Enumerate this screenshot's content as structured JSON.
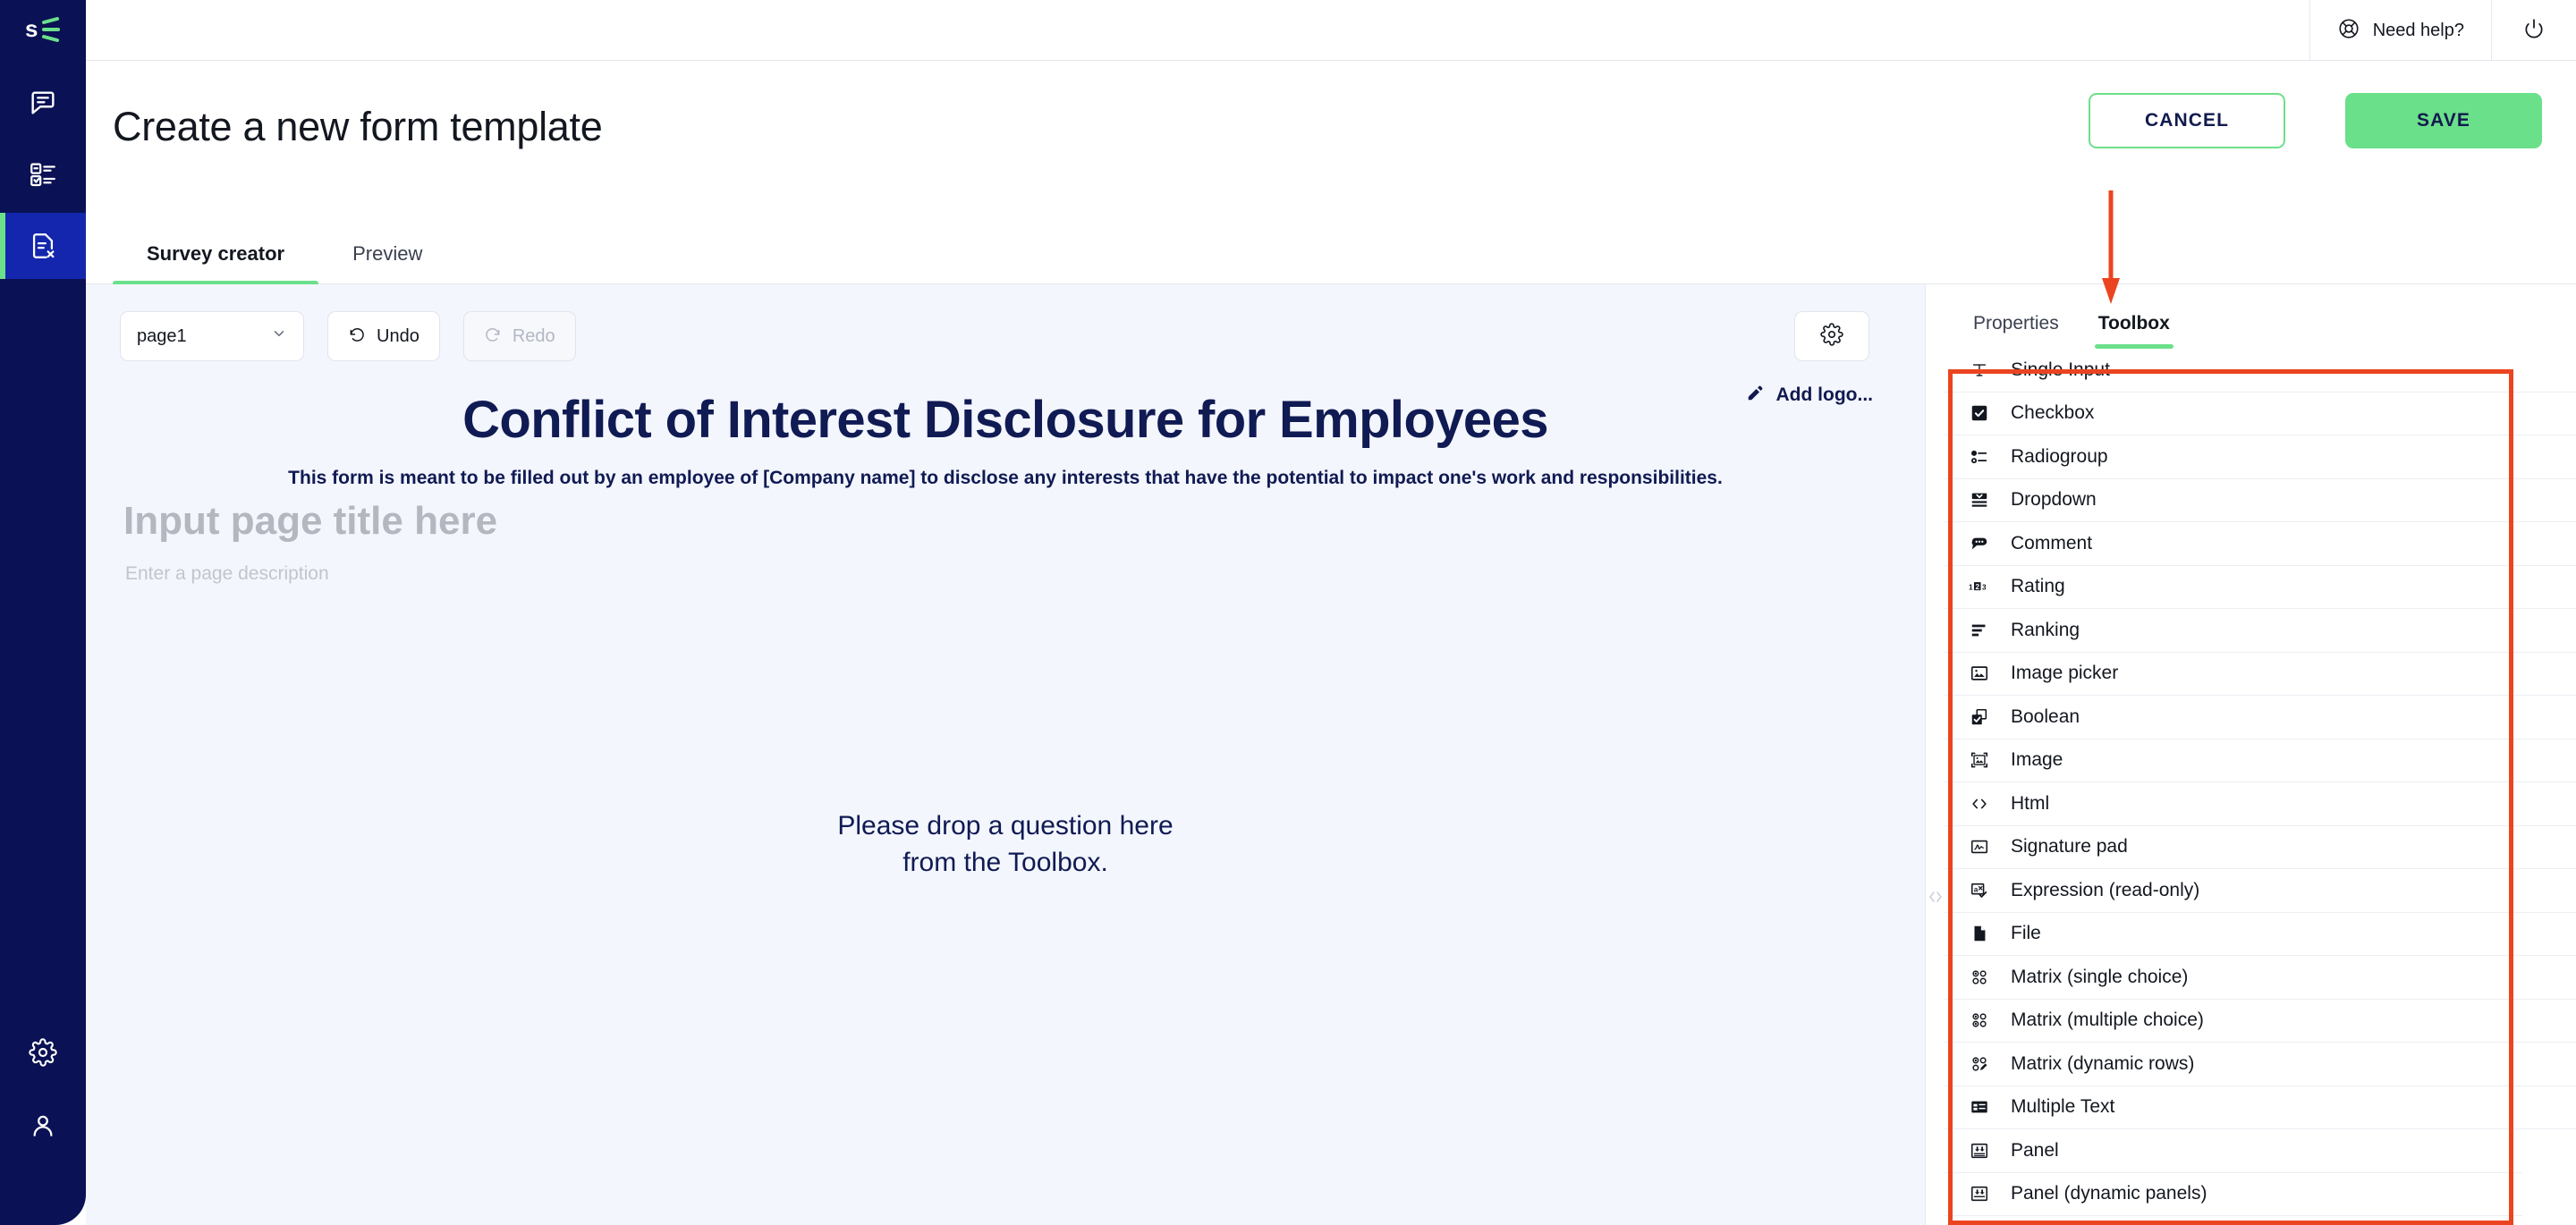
{
  "rail": {
    "logo": "survey-logo",
    "items": [
      {
        "name": "chat-icon",
        "active": false
      },
      {
        "name": "survey-list-icon",
        "active": false
      },
      {
        "name": "form-template-icon",
        "active": true
      },
      {
        "name": "settings-gear-icon",
        "active": false
      },
      {
        "name": "user-profile-icon",
        "active": false
      }
    ]
  },
  "topbar": {
    "help_label": "Need help?",
    "help_icon": "lifebuoy-icon",
    "power_icon": "power-icon"
  },
  "header": {
    "title": "Create a new form template",
    "cancel_label": "CANCEL",
    "save_label": "SAVE"
  },
  "tabs": [
    {
      "label": "Survey creator",
      "active": true
    },
    {
      "label": "Preview",
      "active": false
    }
  ],
  "canvas": {
    "page_select_value": "page1",
    "undo_label": "Undo",
    "redo_label": "Redo",
    "gear_icon": "gear-icon",
    "add_logo_label": "Add logo...",
    "add_logo_icon": "pencil-icon",
    "survey_title": "Conflict of Interest Disclosure for Employees",
    "survey_description": "This form is meant to be filled out by an employee of [Company name] to disclose any interests that have the potential to impact one's work and responsibilities.",
    "page_title_placeholder": "Input page title here",
    "page_description_placeholder": "Enter a page description",
    "dropzone_line1": "Please drop a question here",
    "dropzone_line2": "from the Toolbox."
  },
  "right_panel": {
    "tabs": [
      {
        "label": "Properties",
        "active": false
      },
      {
        "label": "Toolbox",
        "active": true
      }
    ],
    "tools": [
      {
        "label": "Single Input",
        "icon": "text-T-icon"
      },
      {
        "label": "Checkbox",
        "icon": "checkbox-icon"
      },
      {
        "label": "Radiogroup",
        "icon": "radiogroup-icon"
      },
      {
        "label": "Dropdown",
        "icon": "dropdown-icon"
      },
      {
        "label": "Comment",
        "icon": "comment-bubble-icon"
      },
      {
        "label": "Rating",
        "icon": "rating-123-icon"
      },
      {
        "label": "Ranking",
        "icon": "ranking-bars-icon"
      },
      {
        "label": "Image picker",
        "icon": "image-picker-icon"
      },
      {
        "label": "Boolean",
        "icon": "boolean-icon"
      },
      {
        "label": "Image",
        "icon": "image-frame-icon"
      },
      {
        "label": "Html",
        "icon": "code-brackets-icon"
      },
      {
        "label": "Signature pad",
        "icon": "signature-pad-icon"
      },
      {
        "label": "Expression (read-only)",
        "icon": "expression-icon"
      },
      {
        "label": "File",
        "icon": "file-icon"
      },
      {
        "label": "Matrix (single choice)",
        "icon": "matrix-single-icon"
      },
      {
        "label": "Matrix (multiple choice)",
        "icon": "matrix-multiple-icon"
      },
      {
        "label": "Matrix (dynamic rows)",
        "icon": "matrix-dynamic-icon"
      },
      {
        "label": "Multiple Text",
        "icon": "multiple-text-icon"
      },
      {
        "label": "Panel",
        "icon": "panel-icon"
      },
      {
        "label": "Panel (dynamic panels)",
        "icon": "panel-dynamic-icon"
      }
    ]
  },
  "annotations": {
    "highlight_color": "#eb4420",
    "arrow_target": "Toolbox"
  },
  "colors": {
    "rail_bg": "#0a1154",
    "rail_active": "#1326ad",
    "accent_green": "#6be08a",
    "canvas_bg": "#f3f6fd",
    "title_navy": "#101a53",
    "annotation_red": "#eb4420"
  }
}
